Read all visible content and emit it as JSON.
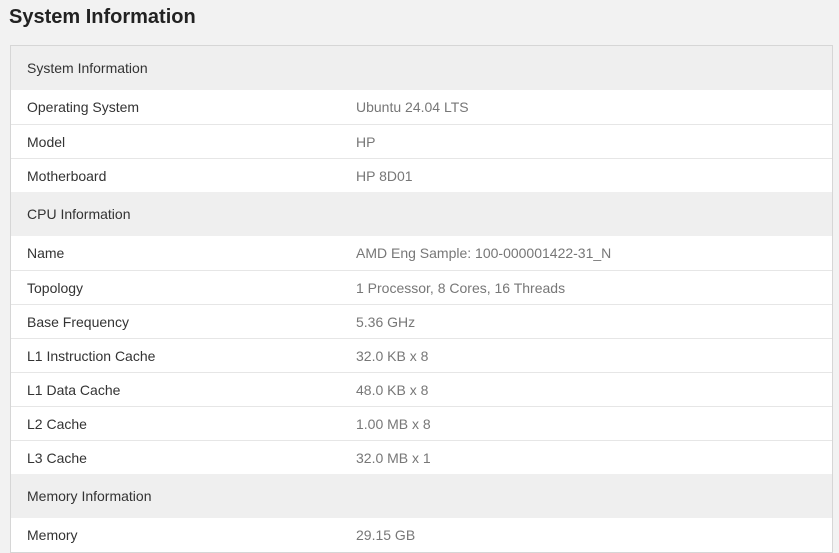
{
  "page_title": "System Information",
  "sections": [
    {
      "title": "System Information",
      "rows": [
        {
          "label": "Operating System",
          "value": "Ubuntu 24.04 LTS"
        },
        {
          "label": "Model",
          "value": "HP"
        },
        {
          "label": "Motherboard",
          "value": "HP 8D01"
        }
      ]
    },
    {
      "title": "CPU Information",
      "rows": [
        {
          "label": "Name",
          "value": "AMD Eng Sample: 100-000001422-31_N"
        },
        {
          "label": "Topology",
          "value": "1 Processor, 8 Cores, 16 Threads"
        },
        {
          "label": "Base Frequency",
          "value": "5.36 GHz"
        },
        {
          "label": "L1 Instruction Cache",
          "value": "32.0 KB x 8"
        },
        {
          "label": "L1 Data Cache",
          "value": "48.0 KB x 8"
        },
        {
          "label": "L2 Cache",
          "value": "1.00 MB x 8"
        },
        {
          "label": "L3 Cache",
          "value": "32.0 MB x 1"
        }
      ]
    },
    {
      "title": "Memory Information",
      "rows": [
        {
          "label": "Memory",
          "value": "29.15 GB"
        }
      ]
    }
  ]
}
